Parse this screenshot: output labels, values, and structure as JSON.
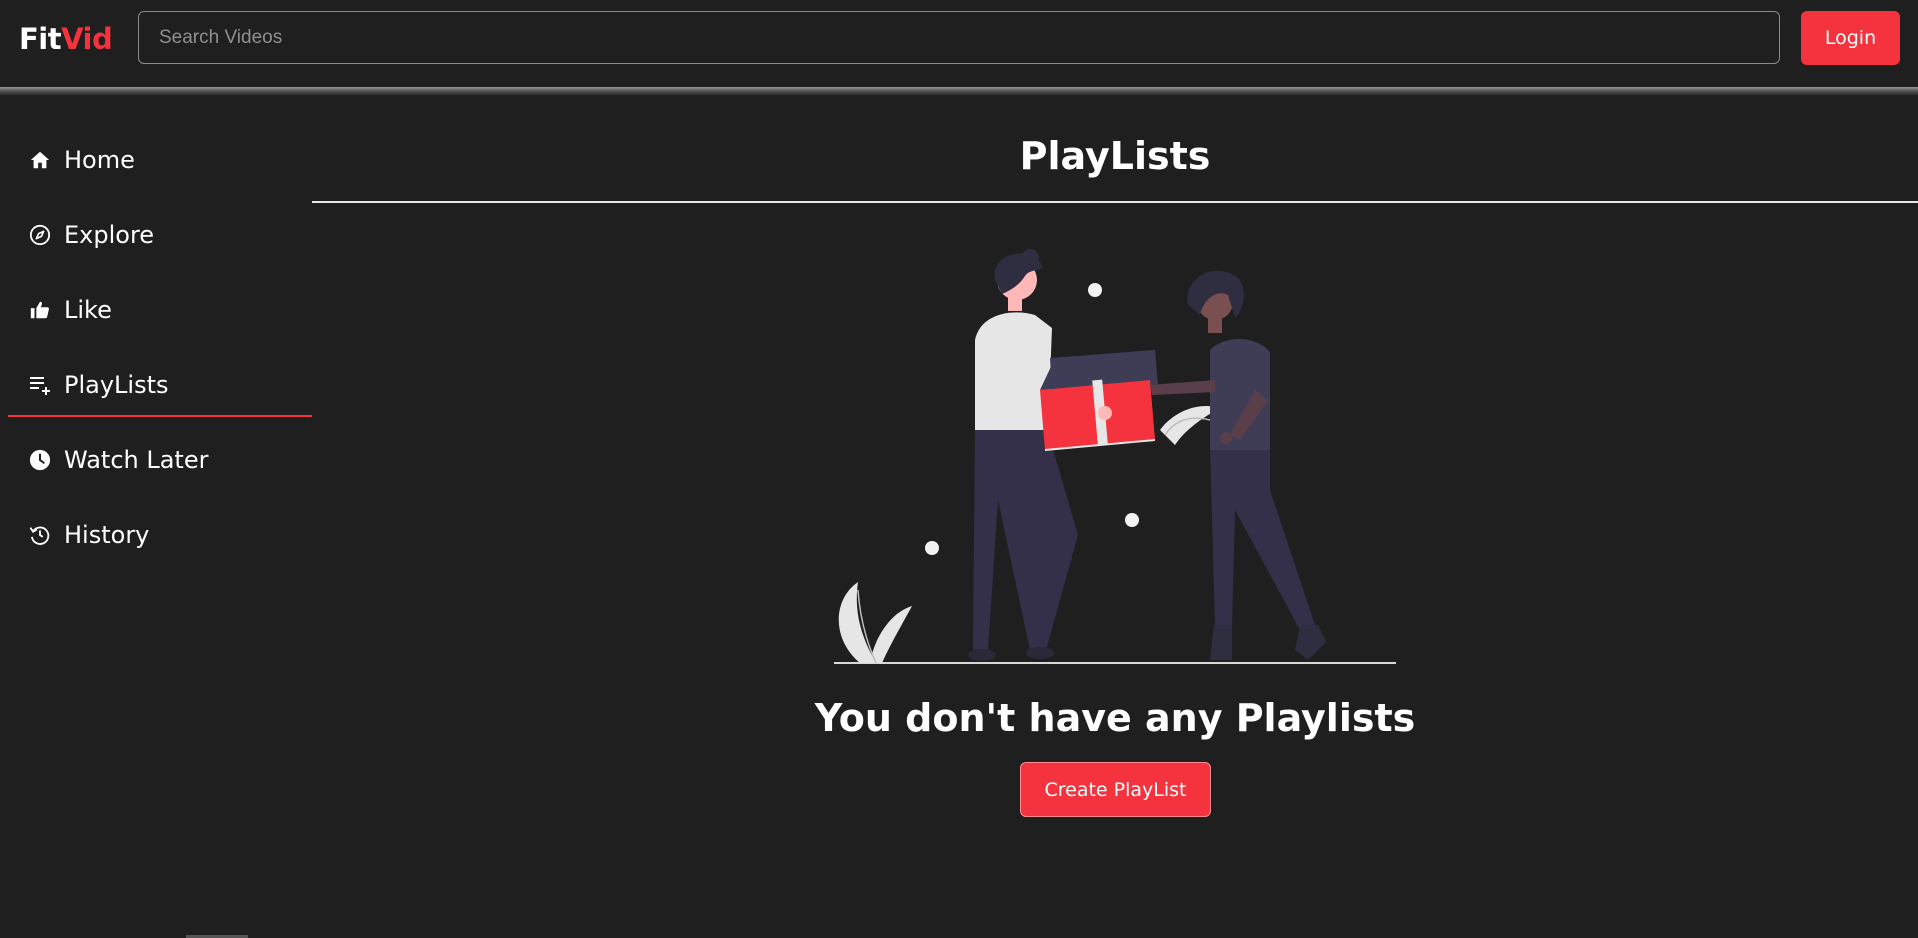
{
  "app": {
    "logo_part1": "Fit",
    "logo_part2": "Vid"
  },
  "header": {
    "search_placeholder": "Search Videos",
    "login_label": "Login"
  },
  "sidebar": {
    "items": [
      {
        "label": "Home",
        "icon": "home-icon"
      },
      {
        "label": "Explore",
        "icon": "compass-icon"
      },
      {
        "label": "Like",
        "icon": "thumbs-up-icon"
      },
      {
        "label": "PlayLists",
        "icon": "playlist-add-icon",
        "active": true
      },
      {
        "label": "Watch Later",
        "icon": "clock-icon"
      },
      {
        "label": "History",
        "icon": "history-icon"
      }
    ]
  },
  "main": {
    "title": "PlayLists",
    "empty_message": "You don't have any Playlists",
    "create_label": "Create PlayList"
  },
  "colors": {
    "accent": "#f5333f",
    "background": "#1f1f1f",
    "text": "#ffffff"
  }
}
